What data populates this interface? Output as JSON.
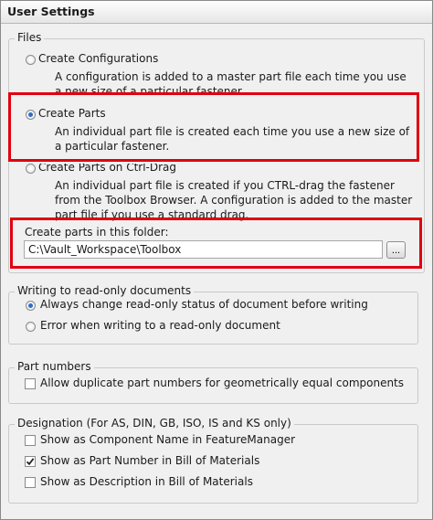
{
  "window": {
    "title": "User Settings"
  },
  "files": {
    "legend": "Files",
    "options": [
      {
        "label": "Create Configurations",
        "description": "A configuration is added to a master part file each time you use a new size of a particular fastener.",
        "selected": false
      },
      {
        "label": "Create Parts",
        "description": "An individual part file is created each time you use a new size of a particular fastener.",
        "selected": true
      },
      {
        "label": "Create Parts on Ctrl-Drag",
        "description": "An individual part file is created if you CTRL-drag the fastener from the Toolbox Browser. A configuration is added to the master part file if you use a standard drag.",
        "selected": false
      }
    ],
    "folder_label": "Create parts in this folder:",
    "folder_value": "C:\\Vault_Workspace\\Toolbox",
    "browse_label": "..."
  },
  "readonly": {
    "legend": "Writing to read-only documents",
    "options": [
      {
        "label": "Always change read-only status of document before writing",
        "selected": true
      },
      {
        "label": "Error when writing to a read-only document",
        "selected": false
      }
    ]
  },
  "part_numbers": {
    "legend": "Part numbers",
    "options": [
      {
        "label": "Allow duplicate part numbers for geometrically equal components",
        "checked": false
      }
    ]
  },
  "designation": {
    "legend": "Designation (For AS, DIN, GB, ISO, IS and KS only)",
    "options": [
      {
        "label": "Show as Component Name in FeatureManager",
        "checked": false
      },
      {
        "label": "Show as Part Number in Bill of Materials",
        "checked": true
      },
      {
        "label": "Show as Description in Bill of Materials",
        "checked": false
      }
    ]
  },
  "colors": {
    "highlight": "#e0000f",
    "radio_dot": "#2a6fc9"
  }
}
